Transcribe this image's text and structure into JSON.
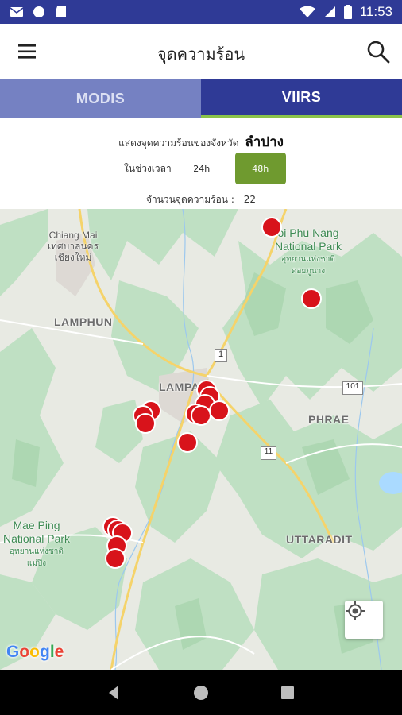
{
  "status_bar": {
    "time": "11:53",
    "icons": [
      "mail-icon",
      "circle-icon",
      "sd-card-icon",
      "wifi-icon",
      "signal-icon",
      "battery-icon"
    ]
  },
  "app_bar": {
    "title": "จุดความร้อน",
    "menu_icon": "menu-icon",
    "search_icon": "search-icon"
  },
  "tabs": [
    {
      "label": "MODIS",
      "selected": false
    },
    {
      "label": "VIIRS",
      "selected": true
    }
  ],
  "info": {
    "province_prefix": "แสดงจุดความร้อนของจังหวัด",
    "province_name": "ลำปาง",
    "period_label": "ในช่วงเวลา",
    "option_24": "24h",
    "option_48": "48h",
    "selected_option": "48h",
    "count_label": "จำนวนจุดความร้อน :",
    "count_value": "22"
  },
  "map": {
    "labels": {
      "chiang_mai_en": "Chiang Mai",
      "chiang_mai_th1": "เทศบาลนคร",
      "chiang_mai_th2": "เชียงใหม่",
      "lamphun": "LAMPHUN",
      "lampang": "LAMPA",
      "phrae": "PHRAE",
      "uttaradit": "UTTARADIT",
      "doi_phu_nang_1": "oi Phu Nang",
      "doi_phu_nang_2": "National Park",
      "doi_phu_nang_th1": "อุทยานแห่งชาติ",
      "doi_phu_nang_th2": "ดอยภูนาง",
      "mae_ping_1": "Mae Ping",
      "mae_ping_2": "National Park",
      "mae_ping_th1": "อุทยานแห่งชาติ",
      "mae_ping_th2": "แม่ปิง",
      "route_1": "1",
      "route_101": "101",
      "route_11": "11"
    },
    "hotspot_count": 22,
    "marker_color": "#d8131b",
    "google_logo": "Google"
  },
  "colors": {
    "primary": "#2f3a96",
    "tab_inactive": "#7581c2",
    "accent_green": "#8bc34a",
    "button_48": "#6f9a2f"
  }
}
